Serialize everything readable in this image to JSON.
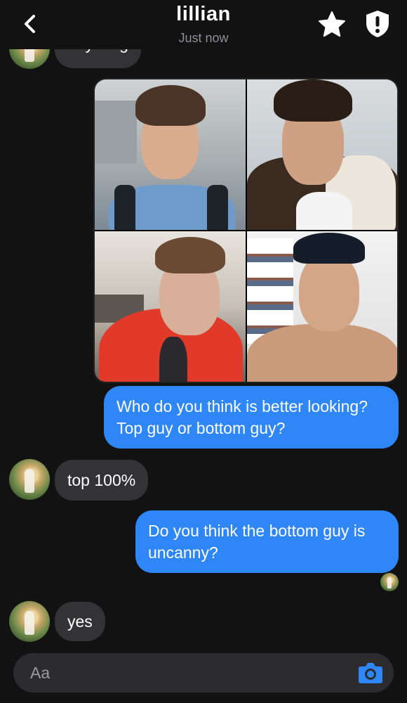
{
  "header": {
    "title": "lillian",
    "status": "Just now"
  },
  "messages": {
    "partial_incoming": "anything",
    "outgoing_1": "Who do you think is better looking? Top guy or bottom guy?",
    "incoming_1": "top 100%",
    "outgoing_2": "Do you think the bottom guy is uncanny?",
    "incoming_2": "yes"
  },
  "photo_grid": {
    "photos": [
      "photo-top-left",
      "photo-top-right",
      "photo-bottom-left",
      "photo-bottom-right"
    ]
  },
  "composer": {
    "placeholder": "Aa"
  },
  "colors": {
    "background": "#121212",
    "outgoing_bubble": "#2f86f6",
    "incoming_bubble": "#333336",
    "composer": "#2c2c2e"
  },
  "icons": [
    "chevron-left-icon",
    "star-icon",
    "shield-alert-icon",
    "camera-icon"
  ]
}
